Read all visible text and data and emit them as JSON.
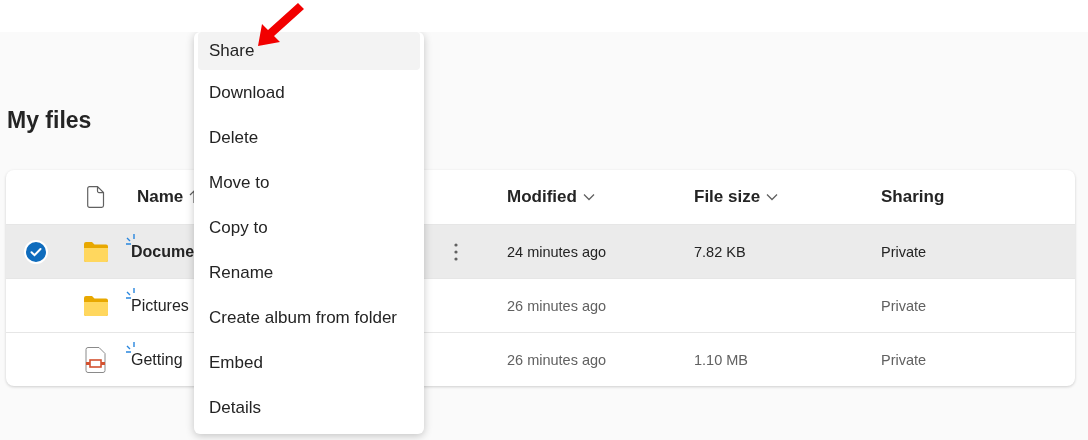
{
  "page_title": "My files",
  "table": {
    "columns": [
      {
        "kind": "icon"
      },
      {
        "kind": "sorted",
        "label": "Name"
      },
      {
        "kind": "dropdown",
        "label": "Modified"
      },
      {
        "kind": "dropdown",
        "label": "File size"
      },
      {
        "kind": "plain",
        "label": "Sharing"
      }
    ],
    "rows": [
      {
        "selected": true,
        "kind": "folder",
        "name": "Docume",
        "new": true,
        "modified": "24 minutes ago",
        "size": "7.82 KB",
        "sharing": "Private"
      },
      {
        "selected": false,
        "kind": "folder",
        "name": "Pictures",
        "new": true,
        "modified": "26 minutes ago",
        "sharing": "Private"
      },
      {
        "selected": false,
        "kind": "slides",
        "name": "Getting",
        "new": true,
        "modified": "26 minutes ago",
        "size": "1.10 MB",
        "sharing": "Private"
      }
    ]
  },
  "context_menu": {
    "items": [
      {
        "label": "Share",
        "highlighted": true
      },
      {
        "label": "Download",
        "highlighted": false
      },
      {
        "label": "Delete",
        "highlighted": false
      },
      {
        "label": "Move to",
        "highlighted": false
      },
      {
        "label": "Copy to",
        "highlighted": false
      },
      {
        "label": "Rename",
        "highlighted": false
      },
      {
        "label": "Create album from folder",
        "highlighted": false
      },
      {
        "label": "Embed",
        "highlighted": false
      },
      {
        "label": "Details",
        "highlighted": false
      }
    ]
  }
}
